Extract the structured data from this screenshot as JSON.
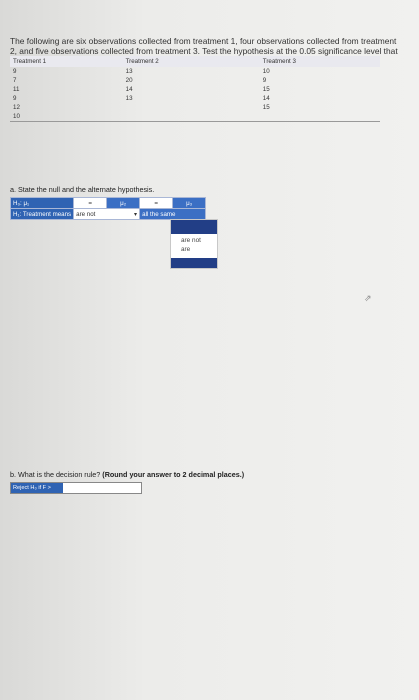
{
  "question": {
    "text": "The following are six observations collected from treatment 1, four observations collected from treatment 2, and five observations collected from treatment 3. Test the hypothesis at the 0.05 significance level that the treatment means are equal."
  },
  "table": {
    "headers": [
      "Treatment 1",
      "Treatment 2",
      "Treatment 3"
    ],
    "rows": [
      [
        "9",
        "13",
        "10"
      ],
      [
        "7",
        "20",
        "9"
      ],
      [
        "11",
        "14",
        "15"
      ],
      [
        "9",
        "13",
        "14"
      ],
      [
        "12",
        "",
        "15"
      ],
      [
        "10",
        "",
        ""
      ]
    ]
  },
  "part_a": {
    "prompt": "a. State the null and the alternate hypothesis.",
    "h0_label": "H₀: μ₁",
    "h0_cells": [
      "=",
      "μ₂",
      "=",
      "μ₃"
    ],
    "h1_label": "H₁: Treatment means",
    "h1_select_value": "are not",
    "h1_tail": "all the same"
  },
  "dropdown": {
    "options": [
      "are not",
      "are"
    ]
  },
  "part_b": {
    "prompt": "b. What is the decision rule?",
    "prompt_bold": "(Round your answer to 2 decimal places.)",
    "input_tag": "Reject H₀ if F >"
  },
  "colors": {
    "accent": "#2f63b3",
    "dropdown_dark": "#223e86"
  }
}
